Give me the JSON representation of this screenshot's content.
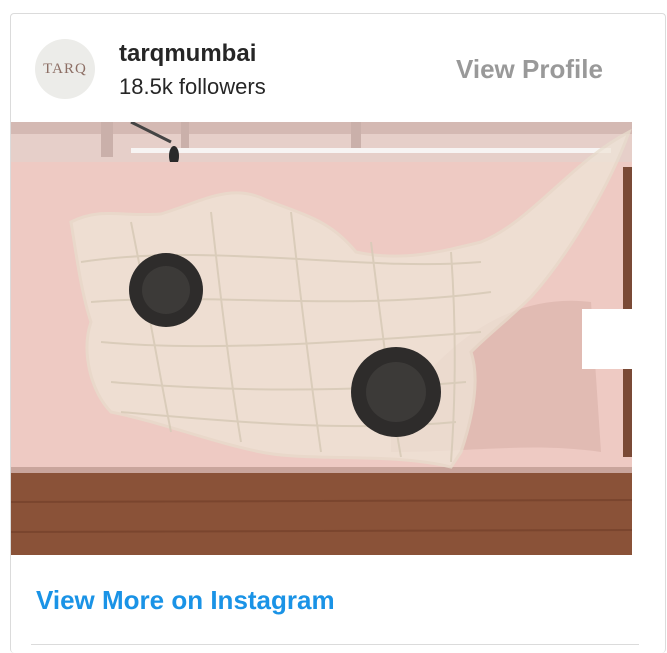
{
  "profile": {
    "avatar_text": "TARQ",
    "username": "tarqmumbai",
    "followers": "18.5k followers",
    "view_profile": "View Profile"
  },
  "media": {
    "artwork_icon": "photo-icon",
    "dots_count": 5,
    "active_dot": 0
  },
  "footer": {
    "view_more": "View More on Instagram"
  },
  "colors": {
    "link": "#1a93e6",
    "muted": "#999999",
    "text": "#262626"
  }
}
